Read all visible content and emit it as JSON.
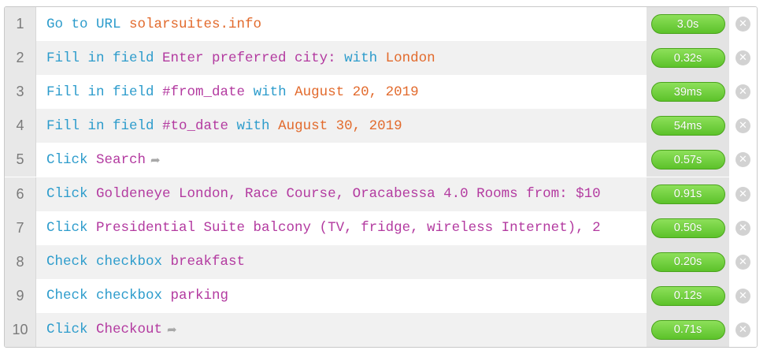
{
  "steps": [
    {
      "num": "1",
      "parts": [
        {
          "t": "Go to URL ",
          "c": "kw"
        },
        {
          "t": "solarsuites.info",
          "c": "vl"
        }
      ],
      "time": "3.0s",
      "arrow": false
    },
    {
      "num": "2",
      "parts": [
        {
          "t": "Fill in field ",
          "c": "kw"
        },
        {
          "t": "Enter preferred city:",
          "c": "tg"
        },
        {
          "t": " with ",
          "c": "kw"
        },
        {
          "t": "London",
          "c": "vl"
        }
      ],
      "time": "0.32s",
      "arrow": false
    },
    {
      "num": "3",
      "parts": [
        {
          "t": "Fill in field ",
          "c": "kw"
        },
        {
          "t": "#from_date",
          "c": "tg"
        },
        {
          "t": " with ",
          "c": "kw"
        },
        {
          "t": "August 20, 2019",
          "c": "vl"
        }
      ],
      "time": "39ms",
      "arrow": false
    },
    {
      "num": "4",
      "parts": [
        {
          "t": "Fill in field ",
          "c": "kw"
        },
        {
          "t": "#to_date",
          "c": "tg"
        },
        {
          "t": " with ",
          "c": "kw"
        },
        {
          "t": "August 30, 2019",
          "c": "vl"
        }
      ],
      "time": "54ms",
      "arrow": false
    },
    {
      "num": "5",
      "parts": [
        {
          "t": "Click ",
          "c": "kw"
        },
        {
          "t": "Search",
          "c": "tg"
        }
      ],
      "time": "0.57s",
      "arrow": true
    },
    {
      "num": "6",
      "parts": [
        {
          "t": "Click ",
          "c": "kw"
        },
        {
          "t": "Goldeneye London, Race Course, Oracabessa 4.0 Rooms from: $10",
          "c": "tg"
        }
      ],
      "time": "0.91s",
      "arrow": false
    },
    {
      "num": "7",
      "parts": [
        {
          "t": "Click ",
          "c": "kw"
        },
        {
          "t": "Presidential Suite balcony (TV, fridge, wireless Internet), 2",
          "c": "tg"
        }
      ],
      "time": "0.50s",
      "arrow": false
    },
    {
      "num": "8",
      "parts": [
        {
          "t": "Check checkbox ",
          "c": "kw"
        },
        {
          "t": "breakfast",
          "c": "tg"
        }
      ],
      "time": "0.20s",
      "arrow": false
    },
    {
      "num": "9",
      "parts": [
        {
          "t": "Check checkbox ",
          "c": "kw"
        },
        {
          "t": "parking",
          "c": "tg"
        }
      ],
      "time": "0.12s",
      "arrow": false
    },
    {
      "num": "10",
      "parts": [
        {
          "t": "Click ",
          "c": "kw"
        },
        {
          "t": "Checkout",
          "c": "tg"
        }
      ],
      "time": "0.71s",
      "arrow": true
    }
  ],
  "icons": {
    "remove": "close-circle-icon",
    "redirect": "redirect-arrow-icon"
  },
  "colors": {
    "keyword": "#2d9ccc",
    "target": "#b33aa0",
    "value": "#e26a2c",
    "duration_pill": "#6fd03c"
  },
  "glyphs": {
    "remove": "✕",
    "redirect": "➦"
  }
}
